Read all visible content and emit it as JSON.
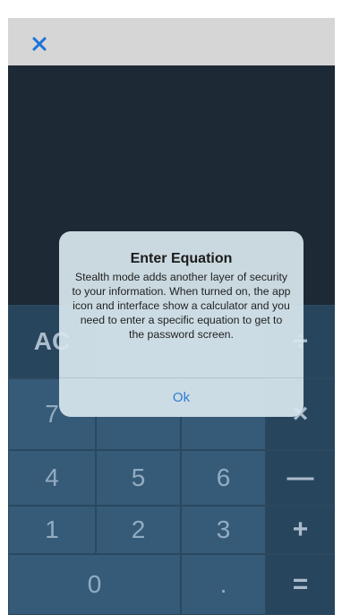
{
  "header": {
    "close_icon": "close-icon"
  },
  "keypad": {
    "ac": "AC",
    "divide": "÷",
    "seven": "7",
    "multiply": "×",
    "four": "4",
    "five": "5",
    "six": "6",
    "minus": "—",
    "one": "1",
    "two": "2",
    "three": "3",
    "plus": "+",
    "zero": "0",
    "dot": ".",
    "equals": "="
  },
  "dialog": {
    "title": "Enter Equation",
    "message": "Stealth mode adds another layer of security to your information. When turned on, the app icon and interface show a calculator and you need to enter a specific equation to get to the password screen.",
    "ok_label": "Ok"
  },
  "colors": {
    "topbar": "#d6d6d6",
    "display": "#1d2935",
    "number_key": "#3d6685",
    "operator_key": "#2b4c66",
    "accent": "#2f7dd1"
  }
}
